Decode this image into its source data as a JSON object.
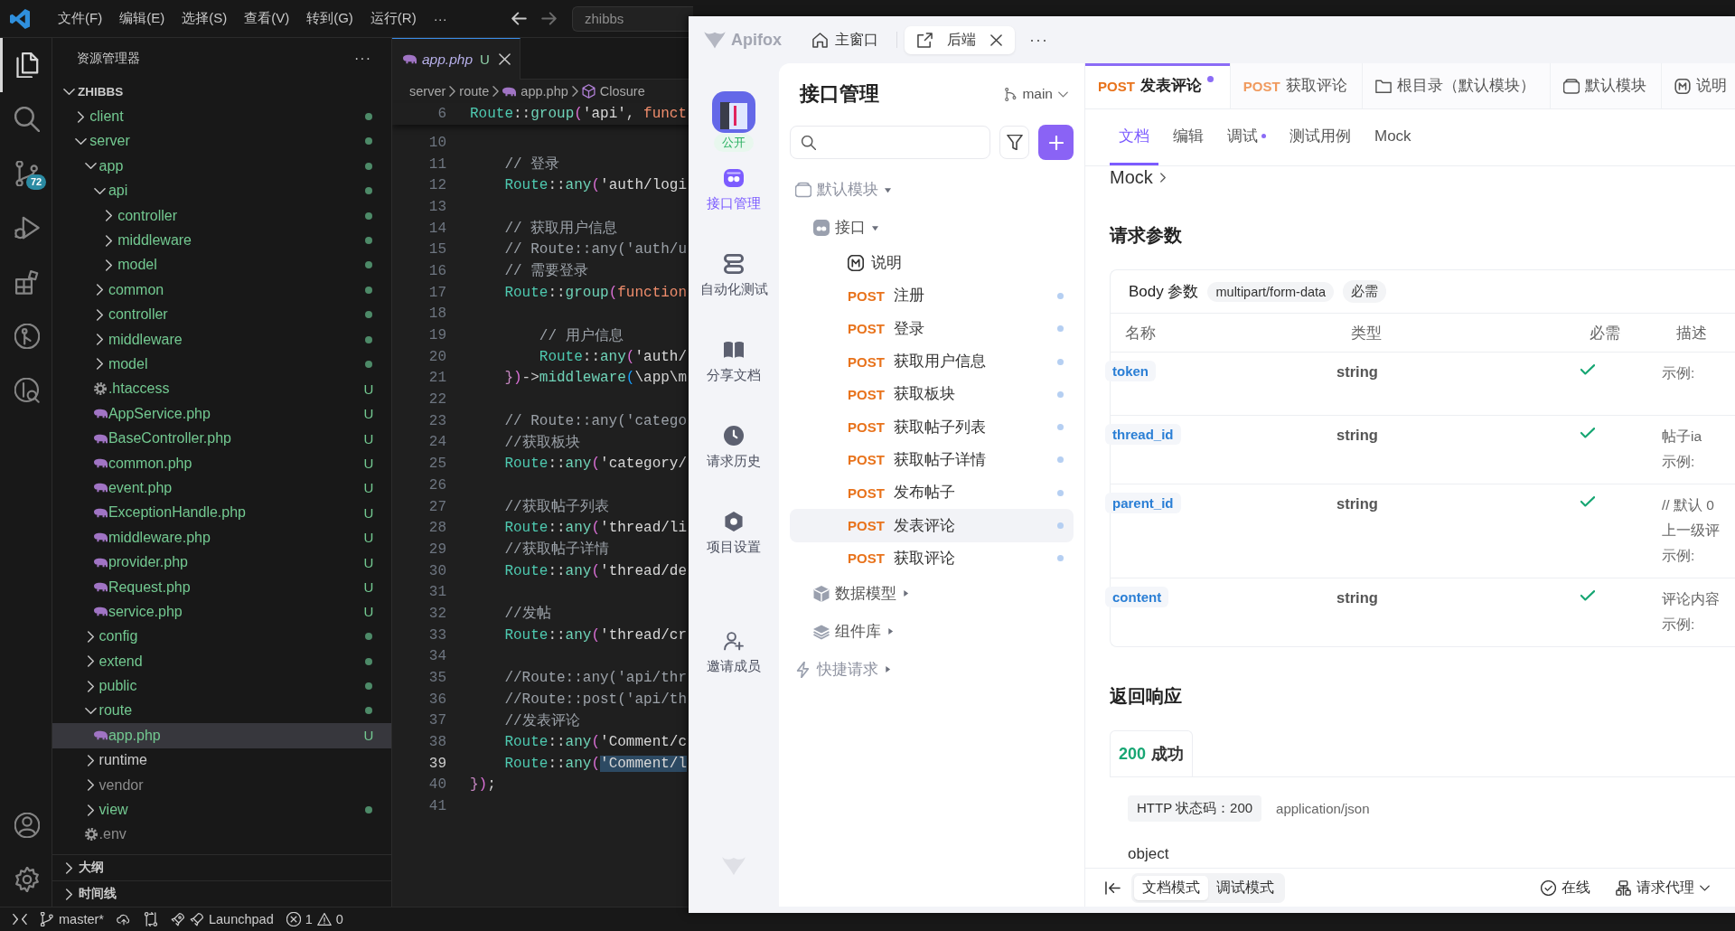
{
  "vscode": {
    "menu": [
      "文件(F)",
      "编辑(E)",
      "选择(S)",
      "查看(V)",
      "转到(G)",
      "运行(R)",
      "···"
    ],
    "search": {
      "value": "zhibbs"
    },
    "activity_bar": [
      {
        "kind": "files",
        "selected": true
      },
      {
        "kind": "search",
        "selected": false
      },
      {
        "kind": "source-control",
        "selected": false,
        "badge": "72"
      },
      {
        "kind": "run-debug",
        "selected": false
      },
      {
        "kind": "extensions",
        "selected": false
      },
      {
        "kind": "git-graph",
        "selected": false
      },
      {
        "kind": "git-search",
        "selected": false
      }
    ],
    "activity_bottom": [
      {
        "kind": "account"
      },
      {
        "kind": "settings"
      }
    ],
    "explorer": {
      "title": "资源管理器",
      "more": "···",
      "root": {
        "name": "ZHIBBS",
        "expanded": true,
        "children": [
          {
            "name": "client",
            "kind": "folder",
            "expanded": false,
            "untracked": true,
            "ignored": false,
            "selected": false
          },
          {
            "name": "server",
            "kind": "folder",
            "expanded": true,
            "untracked": true,
            "ignored": false,
            "selected": false,
            "children": [
              {
                "name": "app",
                "kind": "folder",
                "expanded": true,
                "untracked": true,
                "ignored": false,
                "selected": false,
                "children": [
                  {
                    "name": "api",
                    "kind": "folder",
                    "expanded": true,
                    "untracked": true,
                    "ignored": false,
                    "selected": false,
                    "children": [
                      {
                        "name": "controller",
                        "kind": "folder",
                        "expanded": false,
                        "untracked": true,
                        "ignored": false,
                        "selected": false
                      },
                      {
                        "name": "middleware",
                        "kind": "folder",
                        "expanded": false,
                        "untracked": true,
                        "ignored": false,
                        "selected": false
                      },
                      {
                        "name": "model",
                        "kind": "folder",
                        "expanded": false,
                        "untracked": true,
                        "ignored": false,
                        "selected": false
                      }
                    ]
                  },
                  {
                    "name": "common",
                    "kind": "folder",
                    "expanded": false,
                    "untracked": true,
                    "ignored": false,
                    "selected": false
                  },
                  {
                    "name": "controller",
                    "kind": "folder",
                    "expanded": false,
                    "untracked": true,
                    "ignored": false,
                    "selected": false
                  },
                  {
                    "name": "middleware",
                    "kind": "folder",
                    "expanded": false,
                    "untracked": true,
                    "ignored": false,
                    "selected": false
                  },
                  {
                    "name": "model",
                    "kind": "folder",
                    "expanded": false,
                    "untracked": true,
                    "ignored": false,
                    "selected": false
                  },
                  {
                    "name": ".htaccess",
                    "kind": "config",
                    "untracked": true,
                    "ignored": false,
                    "badge": "U",
                    "selected": false
                  },
                  {
                    "name": "AppService.php",
                    "kind": "php",
                    "untracked": true,
                    "ignored": false,
                    "badge": "U",
                    "selected": false
                  },
                  {
                    "name": "BaseController.php",
                    "kind": "php",
                    "untracked": true,
                    "ignored": false,
                    "badge": "U",
                    "selected": false
                  },
                  {
                    "name": "common.php",
                    "kind": "php",
                    "untracked": true,
                    "ignored": false,
                    "badge": "U",
                    "selected": false
                  },
                  {
                    "name": "event.php",
                    "kind": "php",
                    "untracked": true,
                    "ignored": false,
                    "badge": "U",
                    "selected": false
                  },
                  {
                    "name": "ExceptionHandle.php",
                    "kind": "php",
                    "untracked": true,
                    "ignored": false,
                    "badge": "U",
                    "selected": false
                  },
                  {
                    "name": "middleware.php",
                    "kind": "php",
                    "untracked": true,
                    "ignored": false,
                    "badge": "U",
                    "selected": false
                  },
                  {
                    "name": "provider.php",
                    "kind": "php",
                    "untracked": true,
                    "ignored": false,
                    "badge": "U",
                    "selected": false
                  },
                  {
                    "name": "Request.php",
                    "kind": "php",
                    "untracked": true,
                    "ignored": false,
                    "badge": "U",
                    "selected": false
                  },
                  {
                    "name": "service.php",
                    "kind": "php",
                    "untracked": true,
                    "ignored": false,
                    "badge": "U",
                    "selected": false
                  }
                ]
              },
              {
                "name": "config",
                "kind": "folder",
                "expanded": false,
                "untracked": true,
                "ignored": false,
                "selected": false
              },
              {
                "name": "extend",
                "kind": "folder",
                "expanded": false,
                "untracked": true,
                "ignored": false,
                "selected": false
              },
              {
                "name": "public",
                "kind": "folder",
                "expanded": false,
                "untracked": true,
                "ignored": false,
                "selected": false
              },
              {
                "name": "route",
                "kind": "folder",
                "expanded": true,
                "untracked": true,
                "ignored": false,
                "selected": false,
                "children": [
                  {
                    "name": "app.php",
                    "kind": "php",
                    "untracked": true,
                    "ignored": false,
                    "badge": "U",
                    "selected": true
                  }
                ]
              },
              {
                "name": "runtime",
                "kind": "folder",
                "expanded": false,
                "untracked": false,
                "ignored": false,
                "selected": false
              },
              {
                "name": "vendor",
                "kind": "folder",
                "expanded": false,
                "untracked": false,
                "ignored": true,
                "selected": false
              },
              {
                "name": "view",
                "kind": "folder",
                "expanded": false,
                "untracked": true,
                "ignored": false,
                "selected": false
              },
              {
                "name": ".env",
                "kind": "config",
                "untracked": false,
                "ignored": true,
                "selected": false
              }
            ]
          }
        ]
      }
    },
    "sections": [
      {
        "title": "大纲",
        "expanded": false
      },
      {
        "title": "时间线",
        "expanded": false
      }
    ],
    "editor": {
      "tab": {
        "name": "app.php",
        "badge": "U",
        "selected": true
      },
      "breadcrumbs": [
        {
          "text": "server",
          "kind": "folder"
        },
        {
          "text": "route",
          "kind": "folder"
        },
        {
          "text": "app.php",
          "kind": "php"
        },
        {
          "text": "Closure",
          "kind": "symbol"
        }
      ],
      "sticky": {
        "n": "6",
        "current": false,
        "tokens": [
          {
            "text": "Route",
            "kind": "class"
          },
          {
            "text": "::",
            "kind": "op"
          },
          {
            "text": "group",
            "kind": "fn"
          },
          {
            "text": "(",
            "kind": "paren"
          },
          {
            "text": "'api'",
            "kind": "str"
          },
          {
            "text": ", ",
            "kind": "op"
          },
          {
            "text": "funct",
            "kind": "kw"
          }
        ]
      },
      "lines": [
        {
          "n": "10",
          "current": false
        },
        {
          "n": "11",
          "current": false,
          "tokens": [
            {
              "text": "    // 登录",
              "kind": "comment"
            }
          ]
        },
        {
          "n": "12",
          "current": false,
          "tokens": [
            {
              "text": "    Route",
              "kind": "class"
            },
            {
              "text": "::",
              "kind": "op"
            },
            {
              "text": "any",
              "kind": "fn"
            },
            {
              "text": "(",
              "kind": "paren"
            },
            {
              "text": "'auth/logi",
              "kind": "str"
            }
          ]
        },
        {
          "n": "13",
          "current": false
        },
        {
          "n": "14",
          "current": false,
          "tokens": [
            {
              "text": "    // 获取用户信息",
              "kind": "comment"
            }
          ]
        },
        {
          "n": "15",
          "current": false,
          "tokens": [
            {
              "text": "    // Route::any('auth/u",
              "kind": "comment"
            }
          ]
        },
        {
          "n": "16",
          "current": false,
          "tokens": [
            {
              "text": "    // 需要登录",
              "kind": "comment"
            }
          ]
        },
        {
          "n": "17",
          "current": false,
          "tokens": [
            {
              "text": "    Route",
              "kind": "class"
            },
            {
              "text": "::",
              "kind": "op"
            },
            {
              "text": "group",
              "kind": "fn"
            },
            {
              "text": "(",
              "kind": "paren"
            },
            {
              "text": "function",
              "kind": "kw"
            }
          ]
        },
        {
          "n": "18",
          "current": false
        },
        {
          "n": "19",
          "current": false,
          "tokens": [
            {
              "text": "        // 用户信息",
              "kind": "comment"
            }
          ]
        },
        {
          "n": "20",
          "current": false,
          "tokens": [
            {
              "text": "        Route",
              "kind": "class"
            },
            {
              "text": "::",
              "kind": "op"
            },
            {
              "text": "any",
              "kind": "fn"
            },
            {
              "text": "(",
              "kind": "paren"
            },
            {
              "text": "'auth/",
              "kind": "str"
            }
          ]
        },
        {
          "n": "21",
          "current": false,
          "tokens": [
            {
              "text": "    }",
              "kind": "brace"
            },
            {
              "text": ")",
              "kind": "paren"
            },
            {
              "text": "->",
              "kind": "op"
            },
            {
              "text": "middleware",
              "kind": "fn"
            },
            {
              "text": "(",
              "kind": "paren2"
            },
            {
              "text": "\\app\\m",
              "kind": "plain"
            }
          ]
        },
        {
          "n": "22",
          "current": false
        },
        {
          "n": "23",
          "current": false,
          "tokens": [
            {
              "text": "    // Route::any('catego",
              "kind": "comment"
            }
          ]
        },
        {
          "n": "24",
          "current": false,
          "tokens": [
            {
              "text": "    //获取板块",
              "kind": "comment"
            }
          ]
        },
        {
          "n": "25",
          "current": false,
          "tokens": [
            {
              "text": "    Route",
              "kind": "class"
            },
            {
              "text": "::",
              "kind": "op"
            },
            {
              "text": "any",
              "kind": "fn"
            },
            {
              "text": "(",
              "kind": "paren"
            },
            {
              "text": "'category/",
              "kind": "str"
            }
          ]
        },
        {
          "n": "26",
          "current": false
        },
        {
          "n": "27",
          "current": false,
          "tokens": [
            {
              "text": "    //获取帖子列表",
              "kind": "comment"
            }
          ]
        },
        {
          "n": "28",
          "current": false,
          "tokens": [
            {
              "text": "    Route",
              "kind": "class"
            },
            {
              "text": "::",
              "kind": "op"
            },
            {
              "text": "any",
              "kind": "fn"
            },
            {
              "text": "(",
              "kind": "paren"
            },
            {
              "text": "'thread/li",
              "kind": "str"
            }
          ]
        },
        {
          "n": "29",
          "current": false,
          "tokens": [
            {
              "text": "    //获取帖子详情",
              "kind": "comment"
            }
          ]
        },
        {
          "n": "30",
          "current": false,
          "tokens": [
            {
              "text": "    Route",
              "kind": "class"
            },
            {
              "text": "::",
              "kind": "op"
            },
            {
              "text": "any",
              "kind": "fn"
            },
            {
              "text": "(",
              "kind": "paren"
            },
            {
              "text": "'thread/de",
              "kind": "str"
            }
          ]
        },
        {
          "n": "31",
          "current": false
        },
        {
          "n": "32",
          "current": false,
          "tokens": [
            {
              "text": "    //发帖",
              "kind": "comment"
            }
          ]
        },
        {
          "n": "33",
          "current": false,
          "tokens": [
            {
              "text": "    Route",
              "kind": "class"
            },
            {
              "text": "::",
              "kind": "op"
            },
            {
              "text": "any",
              "kind": "fn"
            },
            {
              "text": "(",
              "kind": "paren"
            },
            {
              "text": "'thread/cr",
              "kind": "str"
            }
          ]
        },
        {
          "n": "34",
          "current": false
        },
        {
          "n": "35",
          "current": false,
          "tokens": [
            {
              "text": "    //Route::any('api/thr",
              "kind": "comment"
            }
          ]
        },
        {
          "n": "36",
          "current": false,
          "tokens": [
            {
              "text": "    //Route::post('api/th",
              "kind": "comment"
            }
          ]
        },
        {
          "n": "37",
          "current": false,
          "tokens": [
            {
              "text": "    //发表评论",
              "kind": "comment"
            }
          ]
        },
        {
          "n": "38",
          "current": false,
          "tokens": [
            {
              "text": "    Route",
              "kind": "class"
            },
            {
              "text": "::",
              "kind": "op"
            },
            {
              "text": "any",
              "kind": "fn"
            },
            {
              "text": "(",
              "kind": "paren"
            },
            {
              "text": "'Comment/c",
              "kind": "str"
            }
          ]
        },
        {
          "n": "39",
          "current": true,
          "tokens": [
            {
              "text": "    Route",
              "kind": "class"
            },
            {
              "text": "::",
              "kind": "op"
            },
            {
              "text": "any",
              "kind": "fn"
            },
            {
              "text": "(",
              "kind": "paren"
            },
            {
              "text": "'Comment/l",
              "kind": "sel"
            }
          ]
        },
        {
          "n": "40",
          "current": false,
          "tokens": [
            {
              "text": "}",
              "kind": "brace"
            },
            {
              "text": ")",
              "kind": "paren"
            },
            {
              "text": ";",
              "kind": "op"
            }
          ]
        },
        {
          "n": "41",
          "current": false
        }
      ]
    },
    "status_bar": {
      "branch": "master*",
      "launchpad": "Launchpad",
      "errors": "1",
      "warnings": "0"
    }
  },
  "apifox": {
    "logo": "Apifox",
    "window_tabs": [
      {
        "label": "主窗口",
        "kind": "home",
        "selected": false,
        "closable": false
      },
      {
        "label": "后端",
        "kind": "project",
        "selected": true,
        "closable": true
      }
    ],
    "more": "···",
    "project": {
      "badge": "公开"
    },
    "nav": [
      {
        "label": "接口管理",
        "kind": "api",
        "selected": true
      },
      {
        "label": "自动化测试",
        "kind": "automation",
        "selected": false
      },
      {
        "label": "分享文档",
        "kind": "share",
        "selected": false
      },
      {
        "label": "请求历史",
        "kind": "history",
        "selected": false
      },
      {
        "label": "项目设置",
        "kind": "settings",
        "selected": false
      },
      {
        "label": "邀请成员",
        "kind": "invite",
        "selected": false
      }
    ],
    "api_panel": {
      "title": "接口管理",
      "branch": "main",
      "tree": [
        {
          "label": "默认模块",
          "kind": "module",
          "expanded": true,
          "selected": false,
          "children": [
            {
              "label": "接口",
              "kind": "folder",
              "expanded": true,
              "selected": false,
              "children": [
                {
                  "label": "说明",
                  "kind": "doc",
                  "selected": false
                },
                {
                  "label": "注册",
                  "kind": "endpoint",
                  "method": "POST",
                  "selected": false
                },
                {
                  "label": "登录",
                  "kind": "endpoint",
                  "method": "POST",
                  "selected": false
                },
                {
                  "label": "获取用户信息",
                  "kind": "endpoint",
                  "method": "POST",
                  "selected": false
                },
                {
                  "label": "获取板块",
                  "kind": "endpoint",
                  "method": "POST",
                  "selected": false
                },
                {
                  "label": "获取帖子列表",
                  "kind": "endpoint",
                  "method": "POST",
                  "selected": false
                },
                {
                  "label": "获取帖子详情",
                  "kind": "endpoint",
                  "method": "POST",
                  "selected": false
                },
                {
                  "label": "发布帖子",
                  "kind": "endpoint",
                  "method": "POST",
                  "selected": false
                },
                {
                  "label": "发表评论",
                  "kind": "endpoint",
                  "method": "POST",
                  "selected": true
                },
                {
                  "label": "获取评论",
                  "kind": "endpoint",
                  "method": "POST",
                  "selected": false
                }
              ]
            },
            {
              "label": "数据模型",
              "kind": "schemas",
              "expanded": false,
              "selected": false
            },
            {
              "label": "组件库",
              "kind": "components",
              "expanded": false,
              "selected": false
            }
          ]
        },
        {
          "label": "快捷请求",
          "kind": "quick",
          "expanded": false,
          "selected": false
        }
      ]
    },
    "doc_tabs": [
      {
        "kind": "endpoint",
        "method": "POST",
        "label": "发表评论",
        "selected": true,
        "modified": true
      },
      {
        "kind": "endpoint",
        "method": "POST",
        "label": "获取评论",
        "selected": false,
        "modified": false
      },
      {
        "kind": "folder",
        "label": "根目录（默认模块）",
        "selected": false,
        "modified": false
      },
      {
        "kind": "module",
        "label": "默认模块",
        "selected": false,
        "modified": false
      },
      {
        "kind": "doc",
        "label": "说明",
        "selected": false,
        "modified": false
      }
    ],
    "view_tabs": [
      {
        "label": "文档",
        "selected": true,
        "dot": false
      },
      {
        "label": "编辑",
        "selected": false,
        "dot": false
      },
      {
        "label": "调试",
        "selected": false,
        "dot": true
      },
      {
        "label": "测试用例",
        "selected": false,
        "dot": false
      },
      {
        "label": "Mock",
        "selected": false,
        "dot": false
      }
    ],
    "crumb": "Mock",
    "request": {
      "title": "请求参数",
      "body_label": "Body 参数",
      "content_type": "multipart/form-data",
      "required_tag": "必需",
      "columns": [
        "名称",
        "类型",
        "必需",
        "描述"
      ],
      "params": [
        {
          "name": "token",
          "type": "string",
          "required": true,
          "description": [
            "示例:"
          ]
        },
        {
          "name": "thread_id",
          "type": "string",
          "required": true,
          "description": [
            "帖子ia",
            "示例:"
          ]
        },
        {
          "name": "parent_id",
          "type": "string",
          "required": true,
          "description": [
            "// 默认 0",
            "上一级评",
            "示例:"
          ]
        },
        {
          "name": "content",
          "type": "string",
          "required": true,
          "description": [
            "评论内容",
            "示例:"
          ]
        }
      ]
    },
    "response": {
      "title": "返回响应",
      "tabs": [
        {
          "code": "200",
          "label": "成功",
          "selected": true
        }
      ],
      "status": "HTTP 状态码：200",
      "content_type": "application/json",
      "schema": "object"
    },
    "footer": {
      "modes": [
        {
          "label": "文档模式",
          "selected": true
        },
        {
          "label": "调试模式",
          "selected": false
        }
      ],
      "online": "在线",
      "proxy": "请求代理"
    }
  }
}
